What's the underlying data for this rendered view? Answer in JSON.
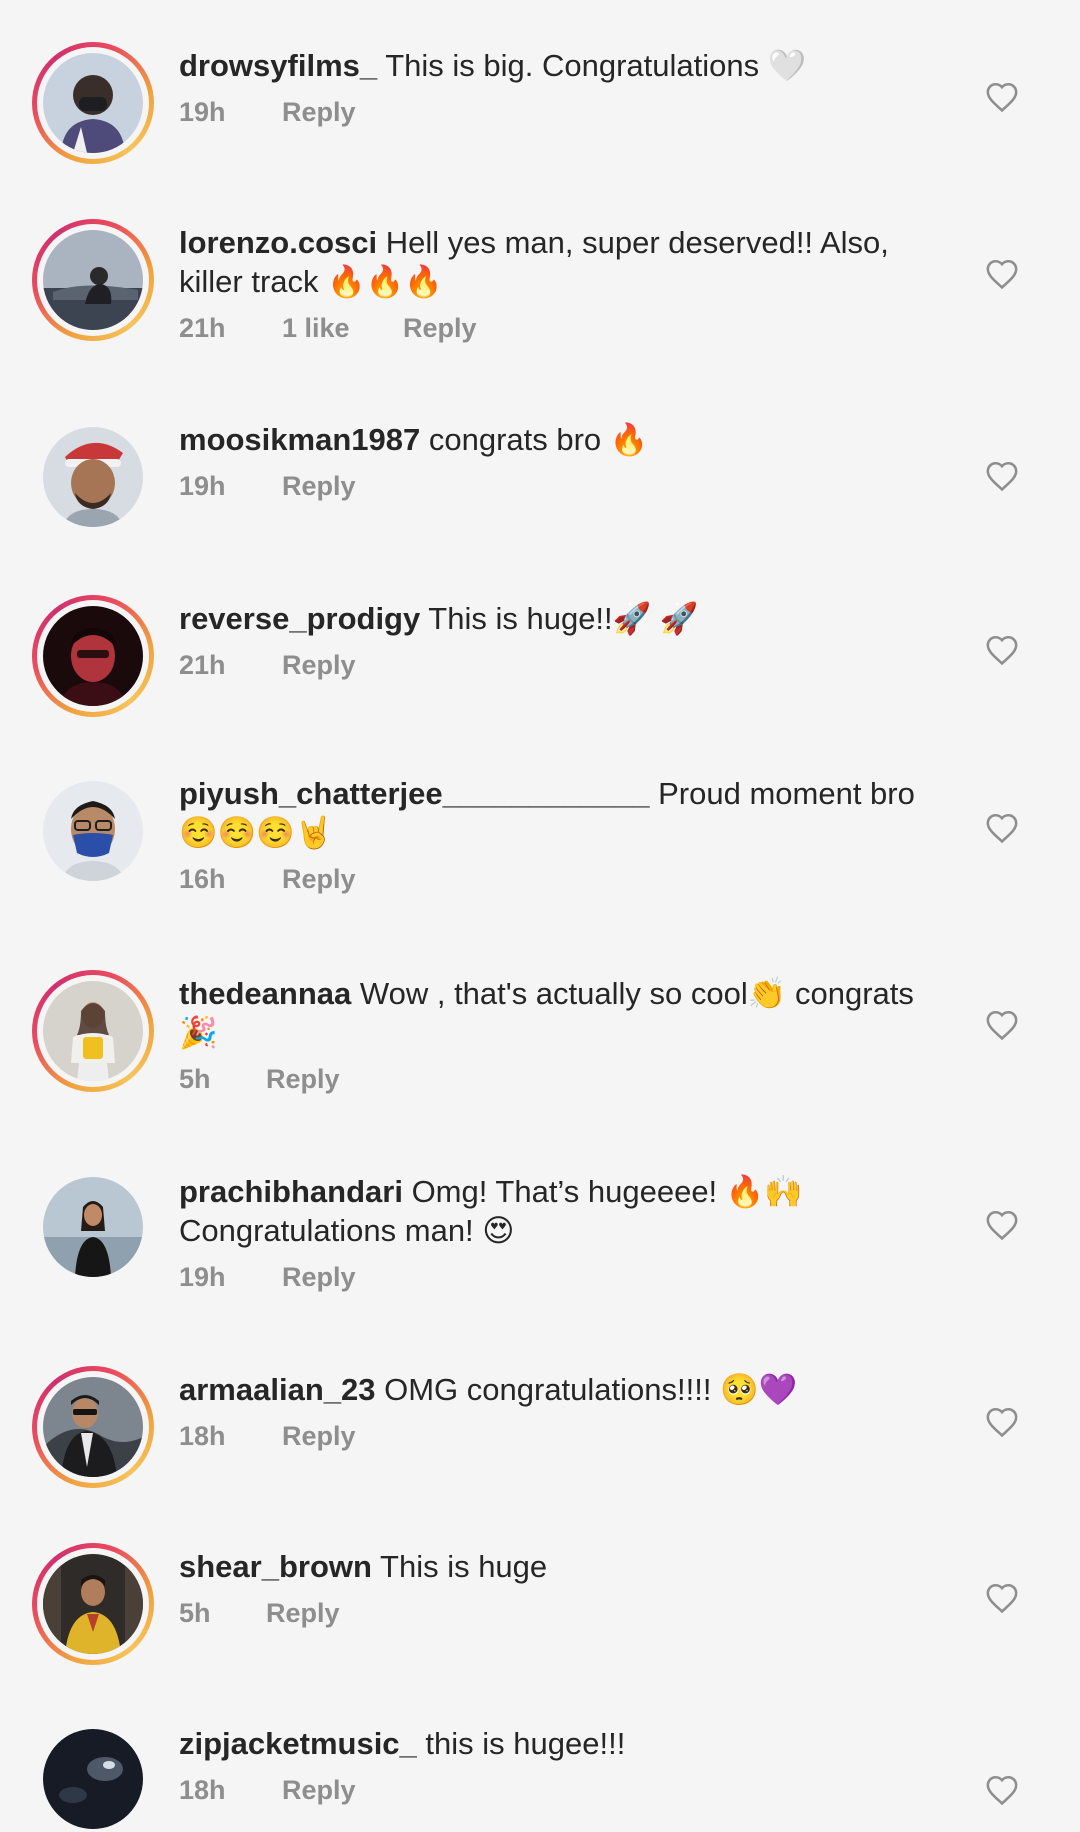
{
  "comments": [
    {
      "username": "drowsyfilms_",
      "text": "This is big. Congratulations 🤍",
      "time": "19h",
      "likes": "",
      "reply": "Reply",
      "story_ring": true,
      "avatar_icon": "person-in-mask-avatar",
      "avatar_color": "#6b7a8f"
    },
    {
      "username": "lorenzo.cosci",
      "text": "Hell yes man, super deserved!! Also, killer track 🔥🔥🔥",
      "time": "21h",
      "likes": "1 like",
      "reply": "Reply",
      "story_ring": true,
      "avatar_icon": "person-outdoors-avatar",
      "avatar_color": "#4d5c6e"
    },
    {
      "username": "moosikman1987",
      "text": "congrats bro 🔥",
      "time": "19h",
      "likes": "",
      "reply": "Reply",
      "story_ring": false,
      "avatar_icon": "person-santa-hat-avatar",
      "avatar_color": "#b8bec8"
    },
    {
      "username": "reverse_prodigy",
      "text": "This is huge!!🚀 🚀",
      "time": "21h",
      "likes": "",
      "reply": "Reply",
      "story_ring": true,
      "avatar_icon": "person-red-light-avatar",
      "avatar_color": "#3a1418"
    },
    {
      "username": "piyush_chatterjee____________",
      "text": "Proud moment bro ☺️☺️☺️🤘",
      "time": "16h",
      "likes": "",
      "reply": "Reply",
      "story_ring": false,
      "avatar_icon": "person-blue-mask-avatar",
      "avatar_color": "#dfe3e8"
    },
    {
      "username": "thedeannaa",
      "text": "Wow , that's actually so cool👏 congrats 🎉",
      "time": "5h",
      "likes": "",
      "reply": "Reply",
      "story_ring": true,
      "avatar_icon": "person-yellow-top-avatar",
      "avatar_color": "#c9c4bc"
    },
    {
      "username": "prachibhandari",
      "text": "Omg! That’s hugeeee! 🔥🙌 Congratulations man! 😍",
      "time": "19h",
      "likes": "",
      "reply": "Reply",
      "story_ring": false,
      "avatar_icon": "person-beach-avatar",
      "avatar_color": "#9fb0bf"
    },
    {
      "username": "armaalian_23",
      "text": "OMG congratulations!!!! 🥺💜",
      "time": "18h",
      "likes": "",
      "reply": "Reply",
      "story_ring": true,
      "avatar_icon": "person-sunglasses-avatar",
      "avatar_color": "#5f6670"
    },
    {
      "username": "shear_brown",
      "text": "This is huge",
      "time": "5h",
      "likes": "",
      "reply": "Reply",
      "story_ring": true,
      "avatar_icon": "person-yellow-jacket-avatar",
      "avatar_color": "#3d3a36"
    },
    {
      "username": "zipjacketmusic_",
      "text": "this is hugee!!!",
      "time": "18h",
      "likes": "",
      "reply": "Reply",
      "story_ring": false,
      "avatar_icon": "abstract-dark-avatar",
      "avatar_color": "#1e2430"
    }
  ],
  "colors": {
    "background": "#f5f5f5",
    "text": "#262626",
    "meta": "#8e8e8e",
    "heart": "#8e8e8e"
  },
  "icons": {
    "like": "heart-outline-icon"
  }
}
